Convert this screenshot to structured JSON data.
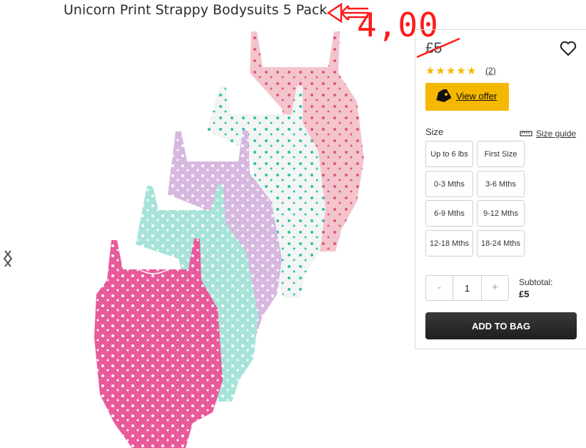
{
  "product": {
    "title": "Unicorn Print Strappy Bodysuits 5 Pack",
    "annotated_price": "4,00",
    "price": "£5",
    "rating_stars": 5,
    "review_count": "(2)"
  },
  "offer": {
    "label": "View offer"
  },
  "size": {
    "label": "Size",
    "guide_label": "Size guide",
    "options": [
      "Up to 6 lbs",
      "First Size",
      "0-3 Mths",
      "3-6 Mths",
      "6-9 Mths",
      "9-12 Mths",
      "12-18 Mths",
      "18-24 Mths"
    ]
  },
  "quantity": {
    "minus": "-",
    "value": "1",
    "plus": "+"
  },
  "subtotal": {
    "label": "Subtotal:",
    "value": "£5"
  },
  "cart": {
    "add_label": "ADD TO BAG"
  },
  "colors": {
    "offer": "#f5b800",
    "annotation": "#ff1a1a",
    "bodysuits": [
      "#f4c4cc",
      "#f2f5f3",
      "#d7b8e0",
      "#a8e3d9",
      "#e85a9b"
    ]
  },
  "icons": [
    "heart-icon",
    "star-icon",
    "tag-icon",
    "ruler-icon",
    "chevron-left-icon",
    "chevron-right-icon"
  ]
}
